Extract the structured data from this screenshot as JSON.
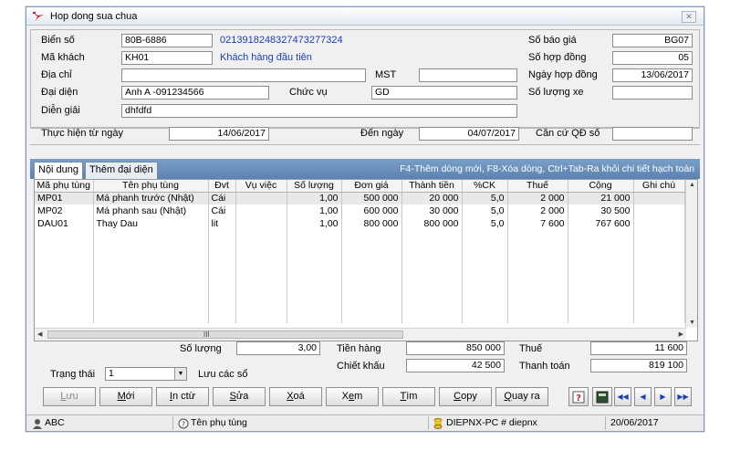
{
  "window": {
    "title": "Hop dong sua chua",
    "close_label": "✕"
  },
  "header": {
    "bien_so": {
      "label": "Biển số",
      "value": "80B-6886",
      "code": "0213918248327473277324"
    },
    "ma_khach": {
      "label": "Mã khách",
      "value": "KH01",
      "name": "Khách hàng đầu tiên"
    },
    "dia_chi": {
      "label": "Địa chỉ",
      "value": ""
    },
    "mst": {
      "label": "MST",
      "value": ""
    },
    "dai_dien": {
      "label": "Đại diện",
      "value": "Anh A -091234566"
    },
    "chuc_vu": {
      "label": "Chức vụ",
      "value": "GD"
    },
    "dien_giai": {
      "label": "Diễn giải",
      "value": "dhfdfd"
    },
    "so_bao_gia": {
      "label": "Số báo giá",
      "value": "BG07"
    },
    "so_hop_dong": {
      "label": "Số hợp đồng",
      "value": "05"
    },
    "ngay_hop_dong": {
      "label": "Ngày hợp đồng",
      "value": "13/06/2017"
    },
    "so_luong_xe": {
      "label": "Số lượng xe",
      "value": ""
    }
  },
  "period": {
    "tu_ngay": {
      "label": "Thực hiện từ ngày",
      "value": "14/06/2017"
    },
    "den_ngay": {
      "label": "Đến ngày",
      "value": "04/07/2017"
    },
    "can_cu": {
      "label": "Căn cứ QĐ số",
      "value": ""
    }
  },
  "tabs": {
    "items": [
      {
        "label": "Nội dung"
      },
      {
        "label": "Thêm đại diện"
      }
    ],
    "hint": "F4-Thêm dòng mới, F8-Xóa dòng, Ctrl+Tab-Ra khỏi chi tiết hạch toán"
  },
  "grid": {
    "columns": [
      "Mã phụ tùng",
      "Tên phụ tùng",
      "Đvt",
      "Vụ việc",
      "Số lượng",
      "Đơn giá",
      "Thành tiền",
      "%CK",
      "Thuế",
      "Cộng",
      "Ghi chú"
    ],
    "rows": [
      [
        "MP01",
        "Má phanh trước (Nhật)",
        "Cái",
        "",
        "1,00",
        "500 000",
        "20 000",
        "5,0",
        "2 000",
        "21 000",
        ""
      ],
      [
        "MP02",
        "Má phanh sau (Nhật)",
        "Cái",
        "",
        "1,00",
        "600 000",
        "30 000",
        "5,0",
        "2 000",
        "30 500",
        ""
      ],
      [
        "DAU01",
        "Thay Dau",
        "lit",
        "",
        "1,00",
        "800 000",
        "800 000",
        "5,0",
        "7 600",
        "767 600",
        ""
      ]
    ],
    "hscroll_mark": "III"
  },
  "totals": {
    "so_luong": {
      "label": "Số lượng",
      "value": "3,00"
    },
    "tien_hang": {
      "label": "Tiền hàng",
      "value": "850 000"
    },
    "chiet_khau": {
      "label": "Chiết khấu",
      "value": "42 500"
    },
    "thue": {
      "label": "Thuế",
      "value": "11 600"
    },
    "thanh_toan": {
      "label": "Thanh toán",
      "value": "819 100"
    },
    "trang_thai": {
      "label": "Trạng thái",
      "value": "1",
      "note": "Lưu các sổ"
    }
  },
  "toolbar": {
    "buttons": [
      {
        "pre": "",
        "u": "L",
        "post": "ưu"
      },
      {
        "pre": "",
        "u": "M",
        "post": "ới"
      },
      {
        "pre": "",
        "u": "I",
        "post": "n ctừ"
      },
      {
        "pre": "",
        "u": "S",
        "post": "ửa"
      },
      {
        "pre": "",
        "u": "X",
        "post": "oá"
      },
      {
        "pre": "X",
        "u": "e",
        "post": "m"
      },
      {
        "pre": "",
        "u": "T",
        "post": "ìm"
      },
      {
        "pre": "",
        "u": "C",
        "post": "opy"
      },
      {
        "pre": "",
        "u": "Q",
        "post": "uay ra"
      }
    ],
    "nav": [
      "◀◀",
      "◀",
      "▶",
      "▶▶"
    ]
  },
  "status": {
    "user": "ABC",
    "field": "Tên phụ tùng",
    "machine": "DIEPNX-PC # diepnx",
    "date": "20/06/2017"
  }
}
